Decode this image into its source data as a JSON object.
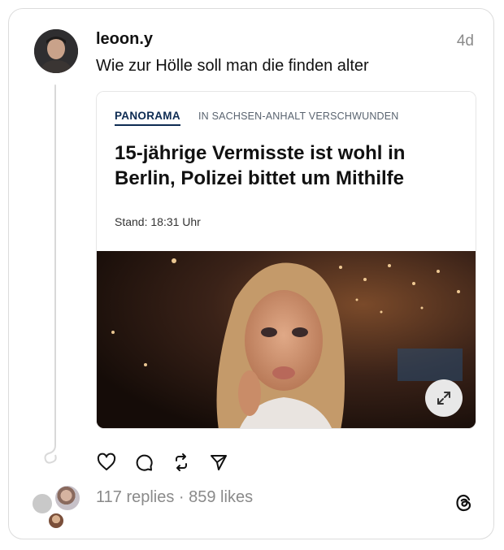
{
  "post": {
    "username": "leoon.y",
    "time": "4d",
    "text": "Wie zur Hölle soll man die finden alter"
  },
  "article": {
    "kicker": "PANORAMA",
    "kicker_sub": "IN SACHSEN-ANHALT VERSCHWUNDEN",
    "headline": "15-jährige Vermisste ist wohl in Berlin, Polizei bittet um Mithilfe",
    "stand": "Stand: 18:31 Uhr"
  },
  "actions": {
    "icons": [
      "heart-icon",
      "comment-icon",
      "repost-icon",
      "share-icon"
    ]
  },
  "stats": {
    "text": "117 replies · 859 likes"
  },
  "colors": {
    "card_border": "#dcdcdc",
    "muted_text": "#8a8a8a",
    "kicker": "#0d2b52"
  }
}
